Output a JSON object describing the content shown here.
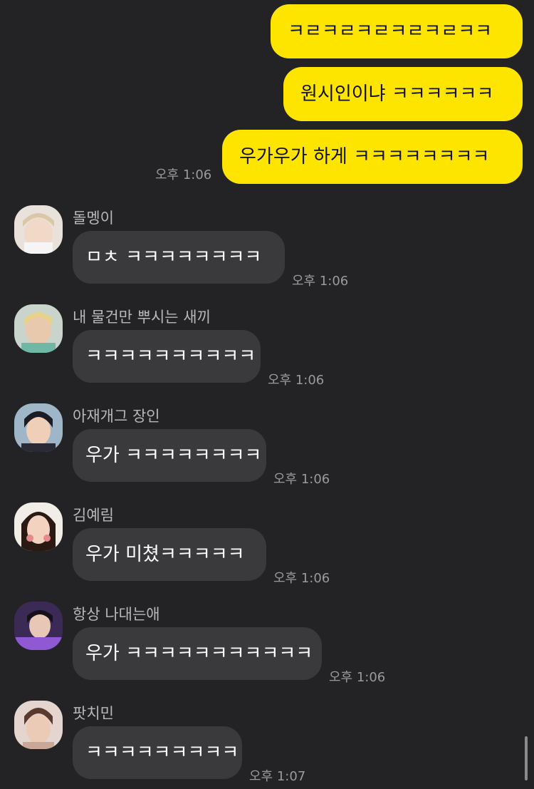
{
  "my_messages": [
    {
      "text": "ㅋㄹㅋㄹㅋㄹㅋㄹㅋㄹㅋㅋ"
    },
    {
      "text": "원시인이냐 ㅋㅋㅋㅋㅋㅋ"
    },
    {
      "text": "우가우가 하게 ㅋㅋㅋㅋㅋㅋㅋㅋ",
      "time": "오후 1:06"
    }
  ],
  "their_messages": [
    {
      "sender": "돌멩이",
      "text": "ㅁㅊ ㅋㅋㅋㅋㅋㅋㅋㅋ",
      "time": "오후 1:06",
      "avatar": "avatar-dolmengi"
    },
    {
      "sender": "내 물건만 뿌시는 새끼",
      "text": "ㅋㅋㅋㅋㅋㅋㅋㅋㅋㅋ",
      "time": "오후 1:06",
      "avatar": "avatar-mulgeon"
    },
    {
      "sender": "아재개그 장인",
      "text": "우가 ㅋㅋㅋㅋㅋㅋㅋㅋ",
      "time": "오후 1:06",
      "avatar": "avatar-ajae"
    },
    {
      "sender": "김예림",
      "text": "우가 미쳤ㅋㅋㅋㅋㅋ",
      "time": "오후 1:06",
      "avatar": "avatar-yerim"
    },
    {
      "sender": "항상 나대는애",
      "text": "우가 ㅋㅋㅋㅋㅋㅋㅋㅋㅋㅋㅋ",
      "time": "오후 1:06",
      "avatar": "avatar-nadae"
    },
    {
      "sender": "팟치민",
      "text": "ㅋㅋㅋㅋㅋㅋㅋㅋㅋ",
      "time": "오후 1:07",
      "avatar": "avatar-patchimin"
    }
  ],
  "colors": {
    "background": "#232325",
    "my_bubble": "#FEE500",
    "their_bubble": "#3A3A3C"
  }
}
